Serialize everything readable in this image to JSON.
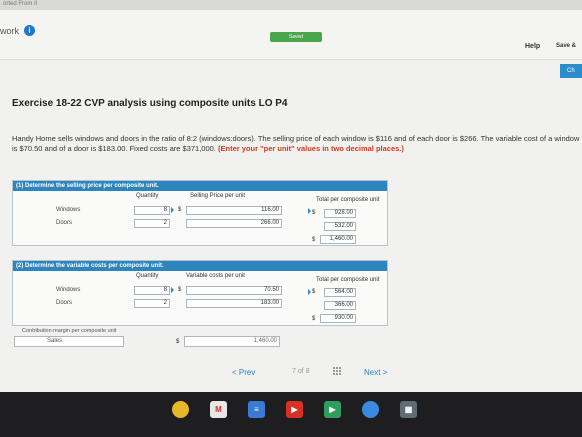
{
  "top_strip": {
    "text": "orted From II"
  },
  "toolbar": {
    "work_label": "work",
    "info_icon": "info-icon",
    "status": "Saved",
    "help": "Help",
    "save": "Save &",
    "check": "Ch"
  },
  "exercise": {
    "title": "Exercise 18-22 CVP analysis using composite units LO P4",
    "text_1": "Handy Home sells windows and doors in the ratio of 8:2 (windows:doors). The selling price of each window is $116 and of each door is $266. The variable cost of a window is $70.50 and of a door is $183.00. Fixed costs are $371,000.",
    "instruction": "(Enter your \"per unit\" values in two decimal places.)"
  },
  "part1": {
    "header": "(1) Determine the selling price per composite unit.",
    "col_quantity": "Quantity",
    "col_price": "Selling Price per unit",
    "col_total": "Total per composite unit",
    "rows": [
      {
        "label": "Windows",
        "quantity": "8",
        "dollar": "$",
        "price": "116.00",
        "total_dollar": "$",
        "total": "928.00"
      },
      {
        "label": "Doors",
        "quantity": "2",
        "dollar": "",
        "price": "266.00",
        "total_dollar": "",
        "total": "532.00"
      }
    ],
    "sum_dollar": "$",
    "sum": "1,460.00"
  },
  "part2": {
    "header": "(2) Determine the variable costs per composite unit.",
    "col_quantity": "Quantity",
    "col_cost": "Variable costs per unit",
    "col_total": "Total per composite unit",
    "rows": [
      {
        "label": "Windows",
        "quantity": "8",
        "dollar": "$",
        "cost": "70.50",
        "total_dollar": "$",
        "total": "564.00"
      },
      {
        "label": "Doors",
        "quantity": "2",
        "dollar": "",
        "cost": "183.00",
        "total_dollar": "",
        "total": "366.00"
      }
    ],
    "sum_dollar": "$",
    "sum": "930.00"
  },
  "contribution": {
    "label": "Contribution margin per composite unit",
    "sales_label": "Sales",
    "dollar": "$",
    "sales_value": "1,460.00"
  },
  "navigation": {
    "prev": "< Prev",
    "page": "7",
    "of": "of",
    "total": "8",
    "next": "Next >"
  },
  "shelf_apps": [
    "chrome-icon",
    "gmail-icon",
    "docs-icon",
    "youtube-icon",
    "play-store-icon",
    "app-icon",
    "files-icon"
  ]
}
